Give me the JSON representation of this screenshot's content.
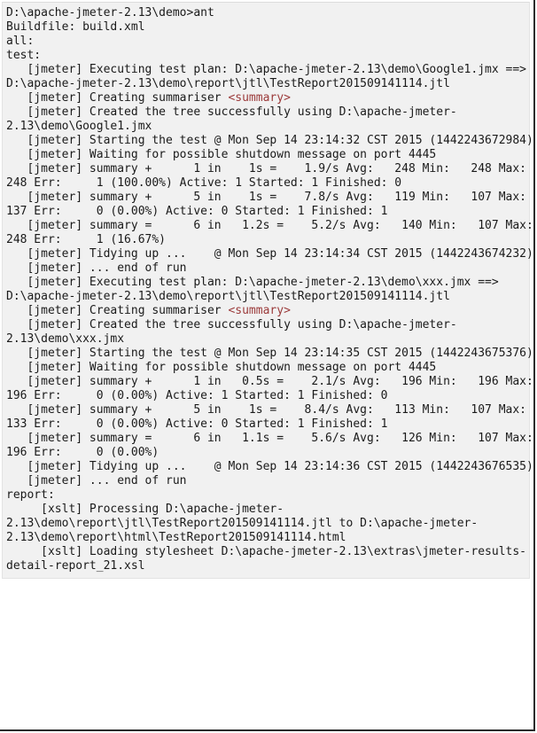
{
  "window": {
    "type": "console-transcript",
    "background_color": "#ffffff",
    "block_background_color": "#f1f1f1",
    "text_color": "#1a1a1a",
    "accent_color": "#9b3a3a"
  },
  "console": {
    "prompt": "D:\\apache-jmeter-2.13\\demo>",
    "command": "ant",
    "lines": [
      {
        "text": "D:\\apache-jmeter-2.13\\demo>ant"
      },
      {
        "text": "Buildfile: build.xml"
      },
      {
        "text": "all:"
      },
      {
        "text": "test:"
      },
      {
        "text": "   [jmeter] Executing test plan: D:\\apache-jmeter-2.13\\demo\\Google1.jmx ==>"
      },
      {
        "text": "D:\\apache-jmeter-2.13\\demo\\report\\jtl\\TestReport201509141114.jtl"
      },
      {
        "pre": "   [jmeter] Creating summariser ",
        "accent": "<summary>",
        "post": ""
      },
      {
        "text": "   [jmeter] Created the tree successfully using D:\\apache-jmeter-"
      },
      {
        "text": "2.13\\demo\\Google1.jmx"
      },
      {
        "text": "   [jmeter] Starting the test @ Mon Sep 14 23:14:32 CST 2015 (1442243672984)"
      },
      {
        "text": "   [jmeter] Waiting for possible shutdown message on port 4445"
      },
      {
        "text": "   [jmeter] summary +      1 in    1s =    1.9/s Avg:   248 Min:   248 Max:"
      },
      {
        "text": "248 Err:     1 (100.00%) Active: 1 Started: 1 Finished: 0"
      },
      {
        "text": "   [jmeter] summary +      5 in    1s =    7.8/s Avg:   119 Min:   107 Max:"
      },
      {
        "text": "137 Err:     0 (0.00%) Active: 0 Started: 1 Finished: 1"
      },
      {
        "text": "   [jmeter] summary =      6 in   1.2s =    5.2/s Avg:   140 Min:   107 Max:"
      },
      {
        "text": "248 Err:     1 (16.67%)"
      },
      {
        "text": "   [jmeter] Tidying up ...    @ Mon Sep 14 23:14:34 CST 2015 (1442243674232)"
      },
      {
        "text": "   [jmeter] ... end of run"
      },
      {
        "text": "   [jmeter] Executing test plan: D:\\apache-jmeter-2.13\\demo\\xxx.jmx ==>"
      },
      {
        "text": "D:\\apache-jmeter-2.13\\demo\\report\\jtl\\TestReport201509141114.jtl"
      },
      {
        "pre": "   [jmeter] Creating summariser ",
        "accent": "<summary>",
        "post": ""
      },
      {
        "text": "   [jmeter] Created the tree successfully using D:\\apache-jmeter-"
      },
      {
        "text": "2.13\\demo\\xxx.jmx"
      },
      {
        "text": "   [jmeter] Starting the test @ Mon Sep 14 23:14:35 CST 2015 (1442243675376)"
      },
      {
        "text": "   [jmeter] Waiting for possible shutdown message on port 4445"
      },
      {
        "text": "   [jmeter] summary +      1 in   0.5s =    2.1/s Avg:   196 Min:   196 Max:"
      },
      {
        "text": "196 Err:     0 (0.00%) Active: 1 Started: 1 Finished: 0"
      },
      {
        "text": "   [jmeter] summary +      5 in    1s =    8.4/s Avg:   113 Min:   107 Max:"
      },
      {
        "text": "133 Err:     0 (0.00%) Active: 0 Started: 1 Finished: 1"
      },
      {
        "text": "   [jmeter] summary =      6 in   1.1s =    5.6/s Avg:   126 Min:   107 Max:"
      },
      {
        "text": "196 Err:     0 (0.00%)"
      },
      {
        "text": "   [jmeter] Tidying up ...    @ Mon Sep 14 23:14:36 CST 2015 (1442243676535)"
      },
      {
        "text": "   [jmeter] ... end of run"
      },
      {
        "text": "report:"
      },
      {
        "text": "     [xslt] Processing D:\\apache-jmeter-"
      },
      {
        "text": "2.13\\demo\\report\\jtl\\TestReport201509141114.jtl to D:\\apache-jmeter-"
      },
      {
        "text": "2.13\\demo\\report\\html\\TestReport201509141114.html"
      },
      {
        "text": "     [xslt] Loading stylesheet D:\\apache-jmeter-2.13\\extras\\jmeter-results-"
      },
      {
        "text": "detail-report_21.xsl"
      }
    ]
  }
}
